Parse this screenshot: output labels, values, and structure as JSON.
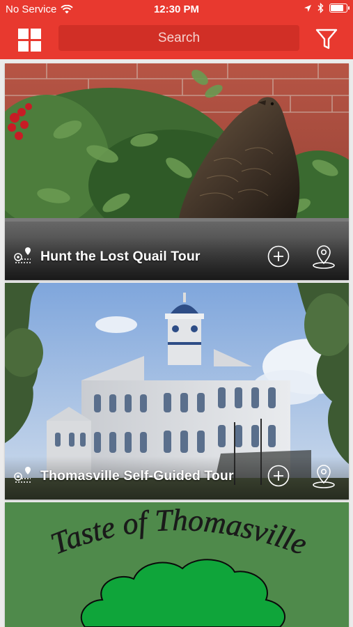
{
  "status_bar": {
    "carrier": "No Service",
    "time": "12:30 PM",
    "battery_level": 0.9
  },
  "header": {
    "search_placeholder": "Search",
    "menu_icon": "grid-icon",
    "filter_icon": "filter-icon"
  },
  "tours": [
    {
      "title": "Hunt the Lost Quail Tour",
      "image": "bronze quail statue on brick planter",
      "add_icon": "plus-circle-icon",
      "map_icon": "map-pin-icon"
    },
    {
      "title": "Thomasville Self-Guided Tour",
      "image": "white historic courthouse with clock tower",
      "add_icon": "plus-circle-icon",
      "map_icon": "map-pin-icon"
    },
    {
      "title": "Taste of Thomasville",
      "image": "green oak tree logo"
    }
  ],
  "colors": {
    "brand_red": "#e8392f",
    "search_bg": "#d12f26",
    "taste_green": "#4f8a4b"
  }
}
